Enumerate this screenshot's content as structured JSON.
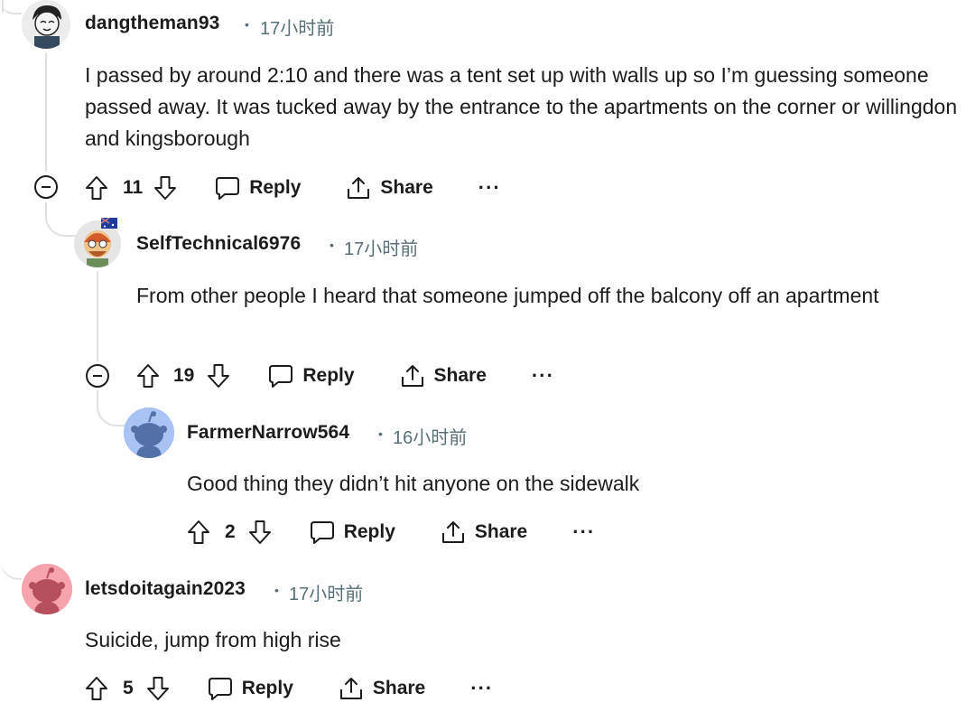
{
  "comments": [
    {
      "username": "dangtheman93",
      "time": "17小时前",
      "body": "I passed by around 2:10 and there was a tent set up with walls up so I’m guessing someone passed away. It was tucked away by the entrance to the apartments on the corner or willingdon and kingsborough",
      "votes": "11",
      "reply_label": "Reply",
      "share_label": "Share",
      "more_label": "···"
    },
    {
      "username": "SelfTechnical6976",
      "time": "17小时前",
      "body": "From other people I heard that someone jumped off the balcony off an apartment",
      "votes": "19",
      "reply_label": "Reply",
      "share_label": "Share",
      "more_label": "···"
    },
    {
      "username": "FarmerNarrow564",
      "time": "16小时前",
      "body": "Good thing they didn’t hit anyone on the sidewalk",
      "votes": "2",
      "reply_label": "Reply",
      "share_label": "Share",
      "more_label": "···"
    },
    {
      "username": "letsdoitagain2023",
      "time": "17小时前",
      "body": "Suicide, jump from high rise",
      "votes": "5",
      "reply_label": "Reply",
      "share_label": "Share",
      "more_label": "···"
    }
  ],
  "separator": "•",
  "colors": {
    "thread_line": "#dfe1e4",
    "meta_text": "#576f76",
    "snoo_blue_bg": "#a9c3f5",
    "snoo_pink_bg": "#f5a3ad"
  },
  "icons": [
    "upvote-icon",
    "downvote-icon",
    "comment-bubble-icon",
    "share-icon",
    "collapse-icon"
  ]
}
